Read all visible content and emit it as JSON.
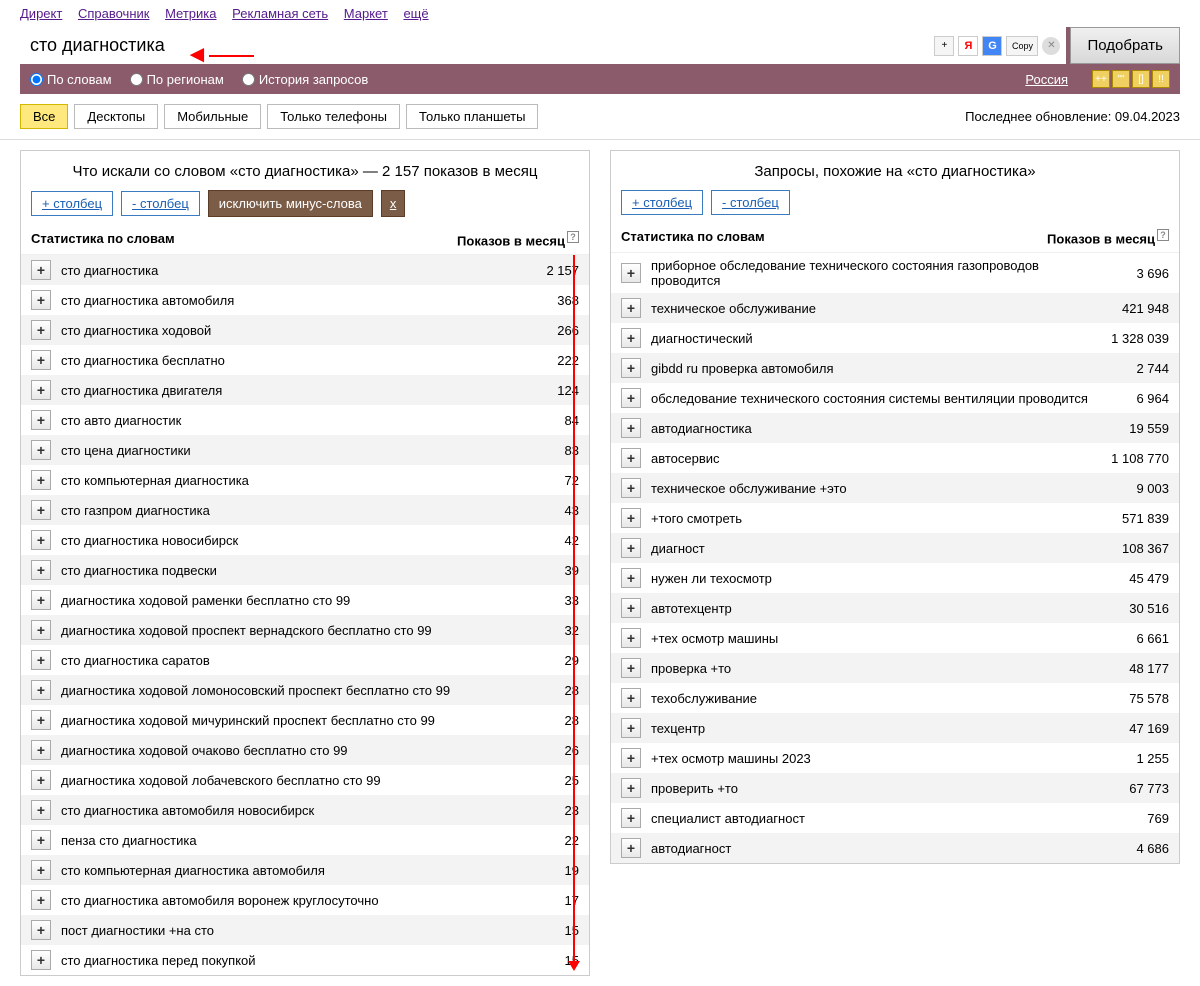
{
  "nav": {
    "links": [
      "Директ",
      "Справочник",
      "Метрика",
      "Рекламная сеть",
      "Маркет",
      "ещё"
    ]
  },
  "search": {
    "value": "сто диагностика",
    "submit": "Подобрать",
    "copy": "Copy"
  },
  "filters": {
    "by_words": "По словам",
    "by_regions": "По регионам",
    "history": "История запросов",
    "region": "Россия"
  },
  "tabs": [
    "Все",
    "Десктопы",
    "Мобильные",
    "Только телефоны",
    "Только планшеты"
  ],
  "update": "Последнее обновление: 09.04.2023",
  "left": {
    "title": "Что искали со словом «сто диагностика» — 2 157 показов в месяц",
    "add_col": "+ столбец",
    "del_col": "- столбец",
    "minus_words": "исключить минус-слова",
    "x": "x",
    "th_left": "Статистика по словам",
    "th_right": "Показов в месяц",
    "rows": [
      {
        "kw": "сто диагностика",
        "cnt": "2 157"
      },
      {
        "kw": "сто диагностика автомобиля",
        "cnt": "368"
      },
      {
        "kw": "сто диагностика ходовой",
        "cnt": "266"
      },
      {
        "kw": "сто диагностика бесплатно",
        "cnt": "222"
      },
      {
        "kw": "сто диагностика двигателя",
        "cnt": "124"
      },
      {
        "kw": "сто авто диагностик",
        "cnt": "84"
      },
      {
        "kw": "сто цена диагностики",
        "cnt": "83"
      },
      {
        "kw": "сто компьютерная диагностика",
        "cnt": "72"
      },
      {
        "kw": "сто газпром диагностика",
        "cnt": "43"
      },
      {
        "kw": "сто диагностика новосибирск",
        "cnt": "42"
      },
      {
        "kw": "сто диагностика подвески",
        "cnt": "39"
      },
      {
        "kw": "диагностика ходовой раменки бесплатно сто 99",
        "cnt": "33"
      },
      {
        "kw": "диагностика ходовой проспект вернадского бесплатно сто 99",
        "cnt": "32"
      },
      {
        "kw": "сто диагностика саратов",
        "cnt": "29"
      },
      {
        "kw": "диагностика ходовой ломоносовский проспект бесплатно сто 99",
        "cnt": "28"
      },
      {
        "kw": "диагностика ходовой мичуринский проспект бесплатно сто 99",
        "cnt": "28"
      },
      {
        "kw": "диагностика ходовой очаково бесплатно сто 99",
        "cnt": "26"
      },
      {
        "kw": "диагностика ходовой лобачевского бесплатно сто 99",
        "cnt": "25"
      },
      {
        "kw": "сто диагностика автомобиля новосибирск",
        "cnt": "23"
      },
      {
        "kw": "пенза сто диагностика",
        "cnt": "22"
      },
      {
        "kw": "сто компьютерная диагностика автомобиля",
        "cnt": "19"
      },
      {
        "kw": "сто диагностика автомобиля воронеж круглосуточно",
        "cnt": "17"
      },
      {
        "kw": "пост диагностики +на сто",
        "cnt": "15"
      },
      {
        "kw": "сто диагностика перед покупкой",
        "cnt": "15"
      }
    ]
  },
  "right": {
    "title": "Запросы, похожие на «сто диагностика»",
    "add_col": "+ столбец",
    "del_col": "- столбец",
    "th_left": "Статистика по словам",
    "th_right": "Показов в месяц",
    "rows": [
      {
        "kw": "приборное обследование технического состояния газопроводов проводится",
        "cnt": "3 696"
      },
      {
        "kw": "техническое обслуживание",
        "cnt": "421 948"
      },
      {
        "kw": "диагностический",
        "cnt": "1 328 039"
      },
      {
        "kw": "gibdd ru проверка автомобиля",
        "cnt": "2 744"
      },
      {
        "kw": "обследование технического состояния системы вентиляции проводится",
        "cnt": "6 964"
      },
      {
        "kw": "автодиагностика",
        "cnt": "19 559"
      },
      {
        "kw": "автосервис",
        "cnt": "1 108 770"
      },
      {
        "kw": "техническое обслуживание +это",
        "cnt": "9 003"
      },
      {
        "kw": "+того смотреть",
        "cnt": "571 839"
      },
      {
        "kw": "диагност",
        "cnt": "108 367"
      },
      {
        "kw": "нужен ли техосмотр",
        "cnt": "45 479"
      },
      {
        "kw": "автотехцентр",
        "cnt": "30 516"
      },
      {
        "kw": "+тех осмотр машины",
        "cnt": "6 661"
      },
      {
        "kw": "проверка +то",
        "cnt": "48 177"
      },
      {
        "kw": "техобслуживание",
        "cnt": "75 578"
      },
      {
        "kw": "техцентр",
        "cnt": "47 169"
      },
      {
        "kw": "+тех осмотр машины 2023",
        "cnt": "1 255"
      },
      {
        "kw": "проверить +то",
        "cnt": "67 773"
      },
      {
        "kw": "специалист автодиагност",
        "cnt": "769"
      },
      {
        "kw": "автодиагност",
        "cnt": "4 686"
      }
    ]
  }
}
